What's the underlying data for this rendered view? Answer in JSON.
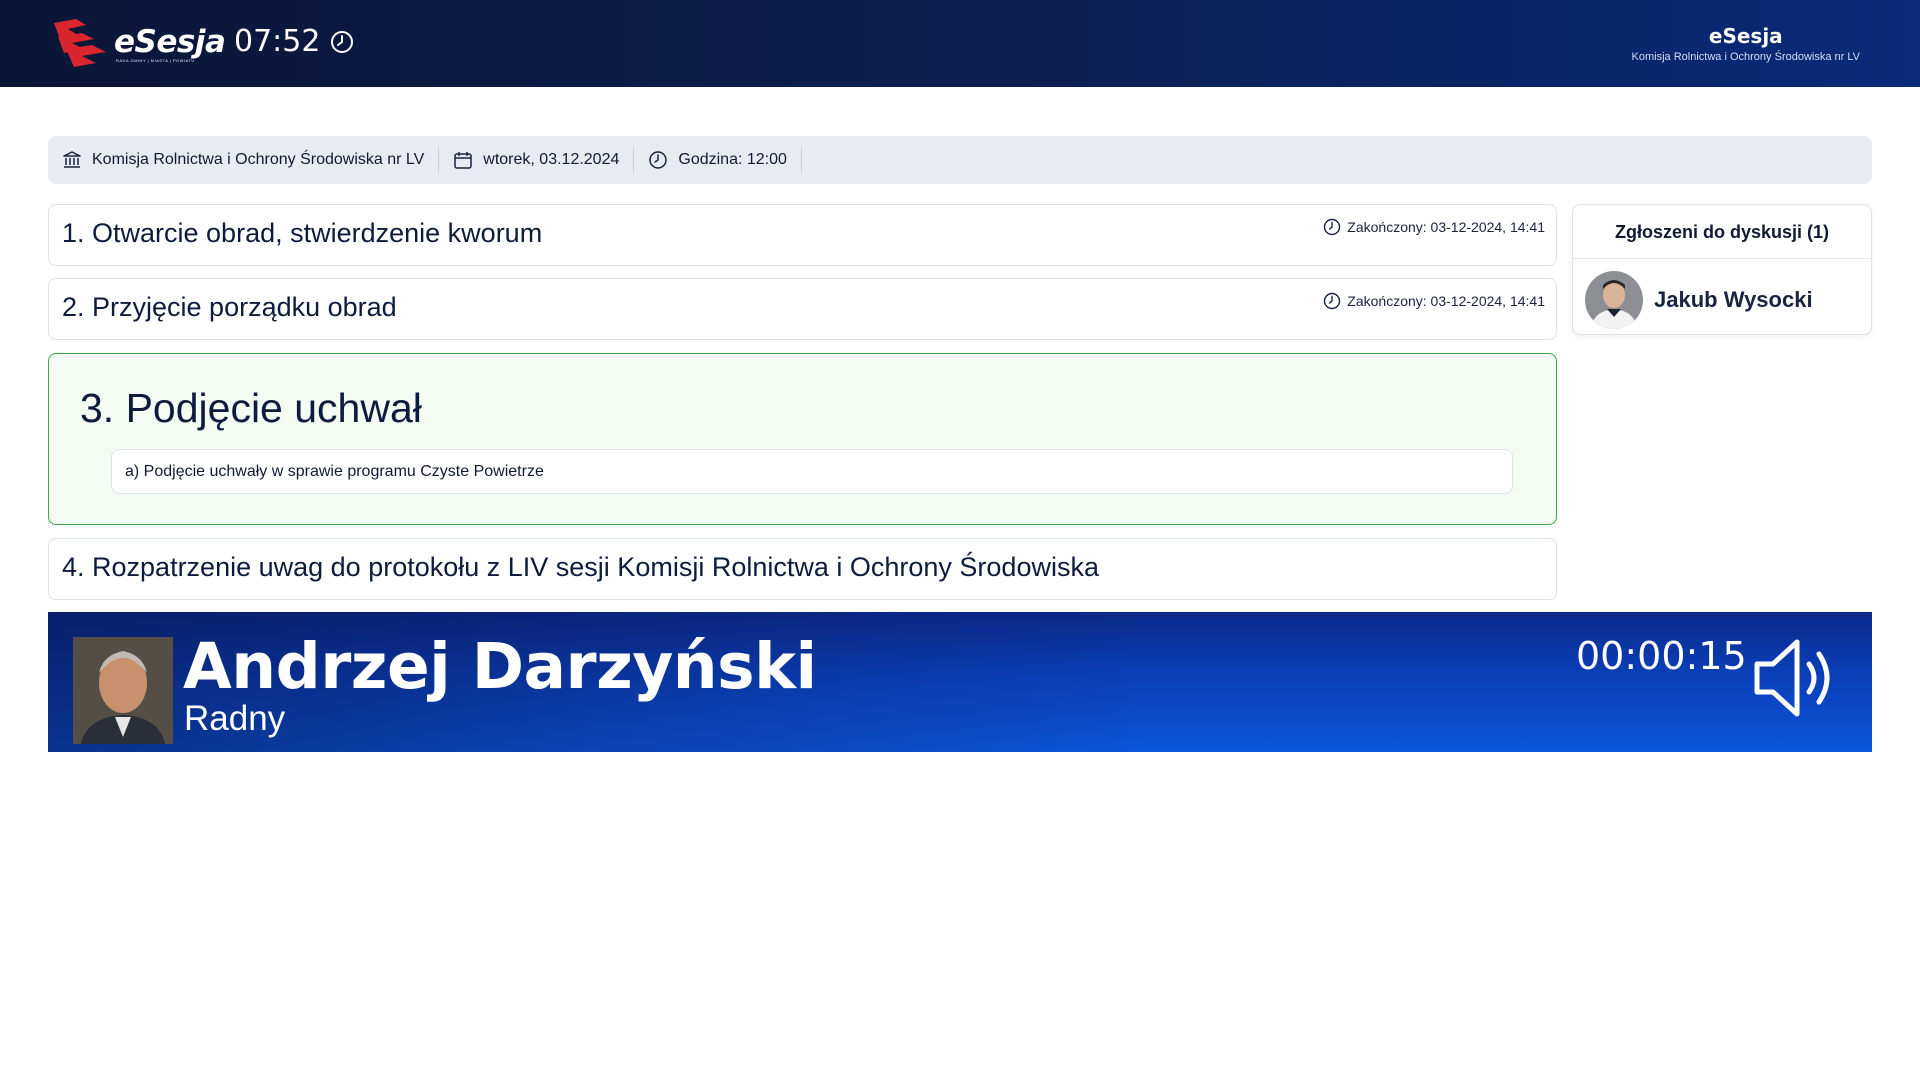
{
  "header": {
    "logo": {
      "word": "eSesja",
      "tagline": "RADA GMINY | MIASTA | POWIATU"
    },
    "time": "07:52",
    "brand_title": "eSesja",
    "brand_subtitle": "Komisja Rolnictwa i Ochrony Środowiska nr LV"
  },
  "info": {
    "committee": "Komisja Rolnictwa i Ochrony Środowiska nr LV",
    "date": "wtorek, 03.12.2024",
    "time": "Godzina: 12:00"
  },
  "agenda": {
    "items": [
      {
        "title": "1. Otwarcie obrad, stwierdzenie kworum",
        "status": "Zakończony: 03-12-2024, 14:41"
      },
      {
        "title": "2. Przyjęcie porządku obrad",
        "status": "Zakończony: 03-12-2024, 14:41"
      },
      {
        "title": "3. Podjęcie uchwał",
        "subitems": [
          "a) Podjęcie uchwały w sprawie programu Czyste Powietrze"
        ]
      },
      {
        "title": "4. Rozpatrzenie uwag do protokołu z LIV sesji Komisji Rolnictwa i Ochrony Środowiska"
      }
    ]
  },
  "discussion": {
    "header": "Zgłoszeni do dyskusji (1)",
    "people": [
      {
        "name": "Jakub Wysocki"
      }
    ]
  },
  "speaker": {
    "name": "Andrzej Darzyński",
    "role": "Radny",
    "timer": "00:00:15"
  },
  "colors": {
    "header_bg": "#0b1f52",
    "speaker_bg": "#0a4bd0",
    "active_border": "#3aa84a",
    "active_bg": "#f4fbf3",
    "logo_red": "#d9262e"
  },
  "icons": [
    "clock-icon",
    "building-icon",
    "calendar-icon",
    "speaker-volume-icon"
  ]
}
